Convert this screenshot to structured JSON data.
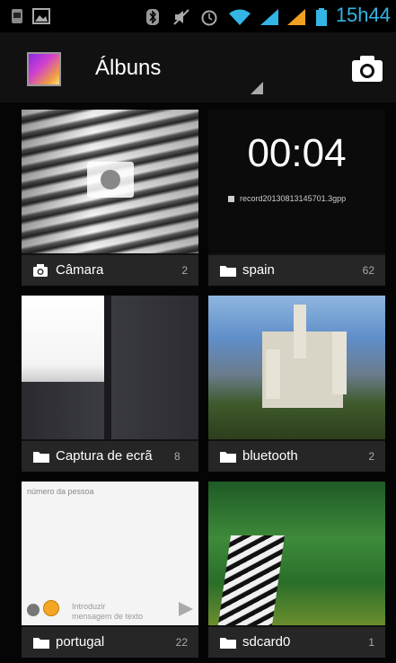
{
  "status_bar": {
    "time": "15h44",
    "icons": [
      "sim-icon",
      "image-notification-icon",
      "bluetooth-icon",
      "mute-icon",
      "alarm-icon",
      "wifi-icon",
      "signal-icon",
      "signal-icon",
      "battery-icon"
    ]
  },
  "action_bar": {
    "title": "Álbuns",
    "accent_color": "#33b5e5"
  },
  "albums": [
    {
      "name": "Câmara",
      "count": "2",
      "icon": "camera-icon"
    },
    {
      "name": "spain",
      "count": "62",
      "icon": "folder-icon",
      "video_time": "00:04",
      "video_file": "record20130813145701.3gpp"
    },
    {
      "name": "Captura de ecrã",
      "count": "8",
      "icon": "folder-icon"
    },
    {
      "name": "bluetooth",
      "count": "2",
      "icon": "folder-icon"
    },
    {
      "name": "portugal",
      "count": "22",
      "icon": "folder-icon",
      "chat_header": "número da pessoa",
      "chat_hint": "Introduzir\nmensagem de texto"
    },
    {
      "name": "sdcard0",
      "count": "1",
      "icon": "folder-icon"
    }
  ]
}
